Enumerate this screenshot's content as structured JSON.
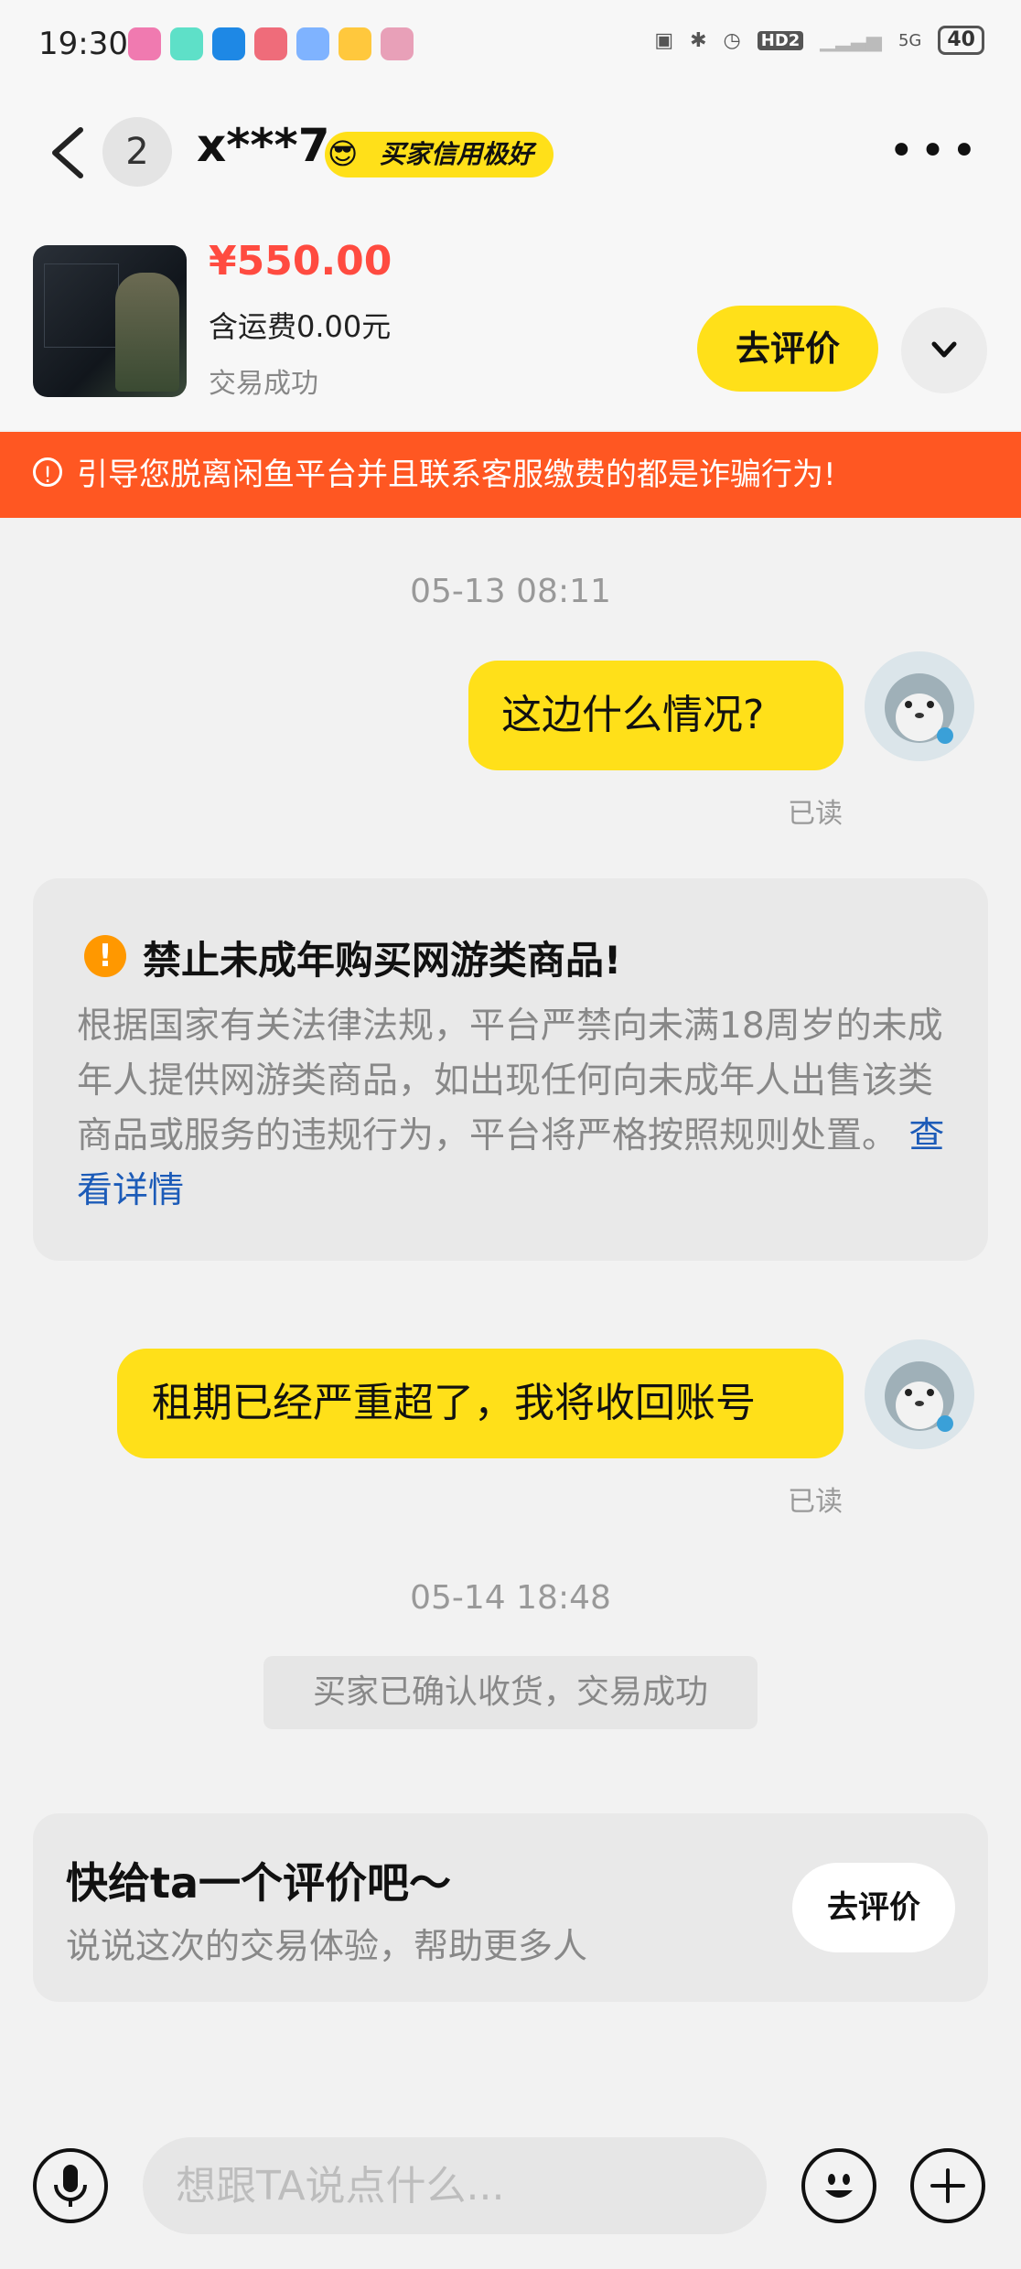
{
  "status_bar": {
    "time": "19:30",
    "network": "5G",
    "hd": "HD2",
    "battery": "40"
  },
  "header": {
    "unread_count": "2",
    "name": "x***7",
    "credit_badge": "买家信用极好",
    "credit_emoji": "😎"
  },
  "product": {
    "price": "¥550.00",
    "shipping": "含运费0.00元",
    "status": "交易成功",
    "review_button": "去评价"
  },
  "warning": "引导您脱离闲鱼平台并且联系客服缴费的都是诈骗行为!",
  "messages": [
    {
      "timestamp": "05-13 08:11",
      "text": "这边什么情况?",
      "read": "已读"
    },
    {
      "text": "租期已经严重超了，我将收回账号",
      "read": "已读"
    }
  ],
  "notice": {
    "title": "禁止未成年购买网游类商品!",
    "body": "根据国家有关法律法规，平台严禁向未满18周岁的未成年人提供网游类商品，如出现任何向未成年人出售该类商品或服务的违规行为，平台将严格按照规则处置。",
    "link": "查看详情"
  },
  "second_timestamp": "05-14 18:48",
  "system_message": "买家已确认收货，交易成功",
  "rating_card": {
    "title": "快给ta一个评价吧～",
    "subtitle": "说说这次的交易体验，帮助更多人",
    "button": "去评价"
  },
  "input": {
    "placeholder": "想跟TA说点什么..."
  },
  "colors": {
    "accent_yellow": "#ffe019",
    "warning_orange": "#ff5722",
    "price_red": "#ff4b40",
    "link_blue": "#1c5bb8"
  }
}
